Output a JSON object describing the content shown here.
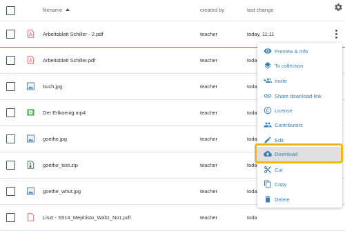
{
  "table": {
    "columns": {
      "filename": "filename",
      "created_by": "created by",
      "last_change": "last change"
    },
    "rows": [
      {
        "name": "Arbeitsblatt Schiller - 2.pdf",
        "created_by": "teacher",
        "last_change": "today, 11:11",
        "icon": "pdf-icon"
      },
      {
        "name": "Arbeitsblatt Schiller.pdf",
        "created_by": "teacher",
        "last_change": "today",
        "icon": "pdf-icon"
      },
      {
        "name": "buch.jpg",
        "created_by": "teacher",
        "last_change": "toda",
        "icon": "image-icon"
      },
      {
        "name": "Der Erlkoenig.mp4",
        "created_by": "teacher",
        "last_change": "toda",
        "icon": "video-icon"
      },
      {
        "name": "goethe.jpg",
        "created_by": "teacher",
        "last_change": "toda",
        "icon": "image-icon"
      },
      {
        "name": "goethe_test.zip",
        "created_by": "teacher",
        "last_change": "toda",
        "icon": "zip-icon"
      },
      {
        "name": "goethe_whut.jpg",
        "created_by": "teacher",
        "last_change": "toda",
        "icon": "image-icon"
      },
      {
        "name": "Liszt - S514_Mephisto_Waltz_No1.pdf",
        "created_by": "teacher",
        "last_change": "toda",
        "icon": "pdf-icon"
      }
    ]
  },
  "menu": {
    "items": [
      {
        "label": "Preview & Info",
        "icon": "eye-icon"
      },
      {
        "label": "To collection",
        "icon": "layers-icon"
      },
      {
        "label": "Invite",
        "icon": "add-people-icon"
      },
      {
        "label": "Share download-link",
        "icon": "link-icon"
      },
      {
        "label": "License",
        "icon": "copyright-icon"
      },
      {
        "label": "Contributors",
        "icon": "people-icon"
      },
      {
        "label": "Edit",
        "icon": "pencil-icon"
      },
      {
        "label": "Download",
        "icon": "cloud-download-icon"
      },
      {
        "label": "Cut",
        "icon": "scissors-icon"
      },
      {
        "label": "Copy",
        "icon": "copy-icon"
      },
      {
        "label": "Delete",
        "icon": "trash-icon"
      }
    ]
  },
  "colors": {
    "accent": "#3c7fb5",
    "highlight": "#f5b800",
    "pdf": "#d9534f",
    "image": "#4a7fb0",
    "video": "#4caf50"
  }
}
